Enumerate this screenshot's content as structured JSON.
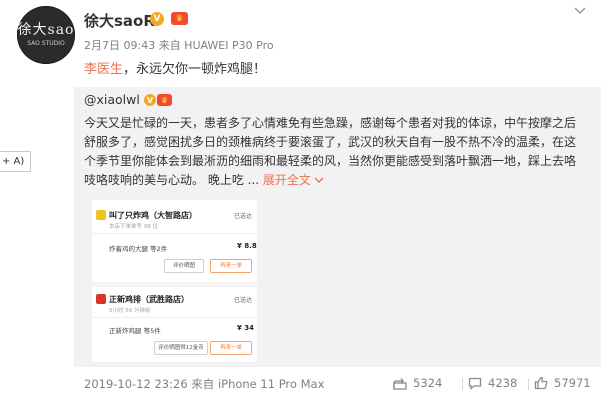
{
  "author": {
    "name": "徐大saoR",
    "avatar_text": "徐大sao",
    "avatar_small": "SAO STUDIO",
    "verified_mark": "V",
    "vip_mark": "♛"
  },
  "post": {
    "meta": "2月7日 09:43 来自 HUAWEI P30 Pro",
    "mention": "李医生",
    "text": "，永远欠你一顿炸鸡腿！",
    "menu_icon": "chevron-down-icon"
  },
  "repost": {
    "user": "@xiaolwl",
    "lines": [
      "今天又是忙碌的一天，患者多了心情难免有些急躁，感谢每个患者对我的体谅，中午按摩之后",
      "舒服多了，感觉困扰多日的颈椎病终于要滚蛋了，武汉的秋天自有一股不热不冷的温柔，在这",
      "个季节里你能体会到最淅沥的细雨和最轻柔的风，当然你更能感受到落叶飘洒一地，踩上去咯",
      "吱咯吱响的美与心动。 晚上吃 ..."
    ],
    "expand_label": "展开全文",
    "expand_icon": "chevron-down-icon"
  },
  "side_tab": {
    "label": "+ A)"
  },
  "order_screenshot": {
    "order1": {
      "shop": "叫了只炸鸡（大智路店）",
      "status": "已送达",
      "sub": "本店下单单号 98 位",
      "item": "炸着鸡的大腿 等2件",
      "price": "¥ 8.8",
      "btn1": "评价晒图",
      "btn2": "再来一单"
    },
    "order2": {
      "shop": "正新鸡排（武胜路店）",
      "status": "已送达",
      "sub": "5小时 56 分钟前",
      "item": "正新炸鸡腿 等5件",
      "price": "¥ 34",
      "btn1": "评价晒图得12金币",
      "btn2": "再来一单"
    }
  },
  "footer": {
    "timestamp": "2019-10-12 23:26 来自 iPhone 11 Pro Max",
    "reposts": "5324",
    "comments": "4238",
    "likes": "57971"
  },
  "colors": {
    "accent": "#eb7350",
    "repost_bg": "#f2f2f5",
    "meta_text": "#808080"
  }
}
